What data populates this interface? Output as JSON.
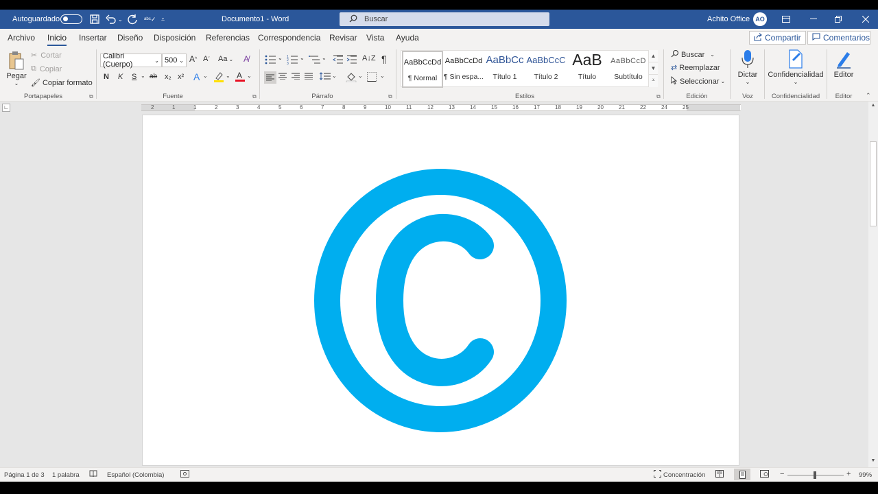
{
  "titlebar": {
    "autosave_label": "Autoguardado",
    "doc_title": "Documento1 - Word",
    "search_placeholder": "Buscar",
    "user_name": "Achito Office",
    "avatar_initials": "AO",
    "accent_color": "#2b579a"
  },
  "tabs": [
    "Archivo",
    "Inicio",
    "Insertar",
    "Diseño",
    "Disposición",
    "Referencias",
    "Correspondencia",
    "Revisar",
    "Vista",
    "Ayuda"
  ],
  "active_tab": "Inicio",
  "share": {
    "share_label": "Compartir",
    "comments_label": "Comentarios"
  },
  "clipboard": {
    "paste": "Pegar",
    "cut": "Cortar",
    "copy": "Copiar",
    "format_painter": "Copiar formato",
    "group": "Portapapeles"
  },
  "font": {
    "name": "Calibri (Cuerpo)",
    "size": "500",
    "case_btn": "Aa",
    "bold": "N",
    "italic": "K",
    "underline": "S",
    "strike": "ab",
    "sub": "x₂",
    "sup": "x²",
    "group": "Fuente"
  },
  "paragraph": {
    "pilcrow": "¶",
    "group": "Párrafo"
  },
  "styles": {
    "items": [
      {
        "sample": "AaBbCcDd",
        "name": "¶ Normal"
      },
      {
        "sample": "AaBbCcDd",
        "name": "¶ Sin espa..."
      },
      {
        "sample": "AaBbCc",
        "name": "Título 1"
      },
      {
        "sample": "AaBbCcC",
        "name": "Título 2"
      },
      {
        "sample": "AaB",
        "name": "Título"
      },
      {
        "sample": "AaBbCcD",
        "name": "Subtítulo"
      }
    ],
    "group": "Estilos"
  },
  "editing": {
    "find": "Buscar",
    "replace": "Reemplazar",
    "select": "Seleccionar",
    "group": "Edición"
  },
  "voice": {
    "dictate": "Dictar",
    "group": "Voz"
  },
  "sensitivity": {
    "label": "Confidencialidad",
    "group": "Confidencialidad"
  },
  "editor": {
    "label": "Editor",
    "group": "Editor"
  },
  "ruler_numbers": [
    "2",
    "1",
    "1",
    "2",
    "3",
    "4",
    "5",
    "6",
    "7",
    "8",
    "9",
    "10",
    "11",
    "12",
    "13",
    "14",
    "15",
    "16",
    "17",
    "18",
    "19",
    "20",
    "21",
    "22",
    "24",
    "25"
  ],
  "document": {
    "content": "©",
    "symbol_color": "#00aeef"
  },
  "status": {
    "page": "Página 1 de 3",
    "words": "1 palabra",
    "language": "Español (Colombia)",
    "focus": "Concentración",
    "zoom": "99%",
    "zoom_minus": "−",
    "zoom_plus": "+"
  }
}
